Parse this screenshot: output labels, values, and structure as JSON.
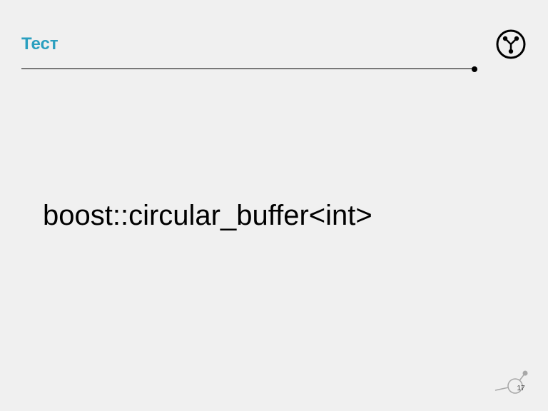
{
  "title": "Тест",
  "content": "boost::circular_buffer<int>",
  "page_number": "17"
}
